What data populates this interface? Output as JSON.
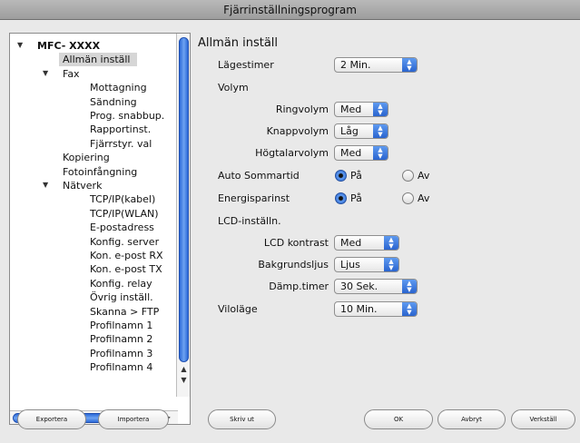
{
  "window": {
    "title": "Fjärrinställningsprogram"
  },
  "tree": {
    "items": [
      {
        "label": "MFC- XXXX",
        "bold": true,
        "indent": 0,
        "disclosure": "▼"
      },
      {
        "label": "Allmän inställ",
        "indent": 1,
        "selected": true
      },
      {
        "label": "Fax",
        "indent": 1,
        "disclosure": "▼"
      },
      {
        "label": "Mottagning",
        "indent": 2
      },
      {
        "label": "Sändning",
        "indent": 2
      },
      {
        "label": "Prog. snabbup.",
        "indent": 2
      },
      {
        "label": "Rapportinst.",
        "indent": 2
      },
      {
        "label": "Fjärrstyr. val",
        "indent": 2
      },
      {
        "label": "Kopiering",
        "indent": 1
      },
      {
        "label": "Fotoinfångning",
        "indent": 1
      },
      {
        "label": "Nätverk",
        "indent": 1,
        "disclosure": "▼"
      },
      {
        "label": "TCP/IP(kabel)",
        "indent": 2
      },
      {
        "label": "TCP/IP(WLAN)",
        "indent": 2
      },
      {
        "label": "E-postadress",
        "indent": 2
      },
      {
        "label": "Konfig. server",
        "indent": 2
      },
      {
        "label": "Kon. e-post RX",
        "indent": 2
      },
      {
        "label": "Kon. e-post TX",
        "indent": 2
      },
      {
        "label": "Konfig. relay",
        "indent": 2
      },
      {
        "label": "Övrig inställ.",
        "indent": 2
      },
      {
        "label": "Skanna > FTP",
        "indent": 2
      },
      {
        "label": "Profilnamn 1",
        "indent": 2
      },
      {
        "label": "Profilnamn 2",
        "indent": 2
      },
      {
        "label": "Profilnamn 3",
        "indent": 2
      },
      {
        "label": "Profilnamn 4",
        "indent": 2
      }
    ],
    "icons": {
      "disclosure": "disclosure-triangle-icon",
      "scroll_up": "scroll-up-arrow-icon",
      "scroll_down": "scroll-down-arrow-icon",
      "scroll_left": "scroll-left-arrow-icon",
      "scroll_right": "scroll-right-arrow-icon"
    }
  },
  "settings": {
    "title": "Allmän inställ",
    "mode_timer": {
      "label": "Lägestimer",
      "value": "2 Min."
    },
    "volume": {
      "heading": "Volym",
      "ring": {
        "label": "Ringvolym",
        "value": "Med"
      },
      "beep": {
        "label": "Knappvolym",
        "value": "Låg"
      },
      "speaker": {
        "label": "Högtalarvolym",
        "value": "Med"
      }
    },
    "auto_dst": {
      "label": "Auto Sommartid",
      "on_label": "På",
      "off_label": "Av",
      "selected": "on"
    },
    "energy_saving": {
      "label": "Energisparinst",
      "on_label": "På",
      "off_label": "Av",
      "selected": "on"
    },
    "lcd": {
      "heading": "LCD-inställn.",
      "contrast": {
        "label": "LCD kontrast",
        "value": "Med"
      },
      "backlight": {
        "label": "Bakgrundsljus",
        "value": "Ljus"
      },
      "dim_timer": {
        "label": "Dämp.timer",
        "value": "30 Sek."
      }
    },
    "sleep_mode": {
      "label": "Viloläge",
      "value": "10 Min."
    }
  },
  "buttons": {
    "export": "Exportera",
    "import": "Importera",
    "print": "Skriv ut",
    "ok": "OK",
    "cancel": "Avbryt",
    "apply": "Verkställ"
  },
  "colors": {
    "accent": "#2a64cf",
    "selection": "#d6d6d6"
  }
}
